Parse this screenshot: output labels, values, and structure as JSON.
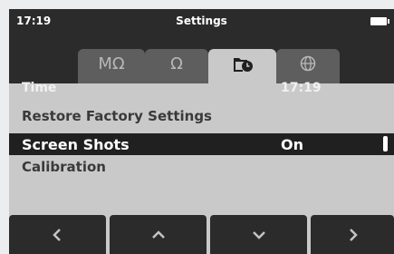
{
  "status": {
    "time": "17:19",
    "title": "Settings",
    "battery_icon": "battery-icon"
  },
  "tabs": [
    {
      "label": "MΩ",
      "icon": "megaohm-icon",
      "active": false
    },
    {
      "label": "Ω",
      "icon": "ohm-icon",
      "active": false
    },
    {
      "label": "",
      "icon": "folder-clock-icon",
      "active": true
    },
    {
      "label": "",
      "icon": "globe-icon",
      "active": false
    }
  ],
  "settings": {
    "time": {
      "label": "Time",
      "value": "17:19"
    },
    "restore": {
      "label": "Restore Factory Settings"
    },
    "screenshots": {
      "label": "Screen Shots",
      "value": "On",
      "selected": true
    },
    "calibration": {
      "label": "Calibration"
    }
  },
  "softkeys": [
    {
      "icon": "chevron-left-icon"
    },
    {
      "icon": "chevron-up-icon"
    },
    {
      "icon": "chevron-down-icon"
    },
    {
      "icon": "chevron-right-icon"
    }
  ],
  "colors": {
    "bar": "#2b2b2b",
    "panel": "#c9c9c9",
    "selection": "#202020",
    "tab_inactive": "#5e5e5e"
  }
}
